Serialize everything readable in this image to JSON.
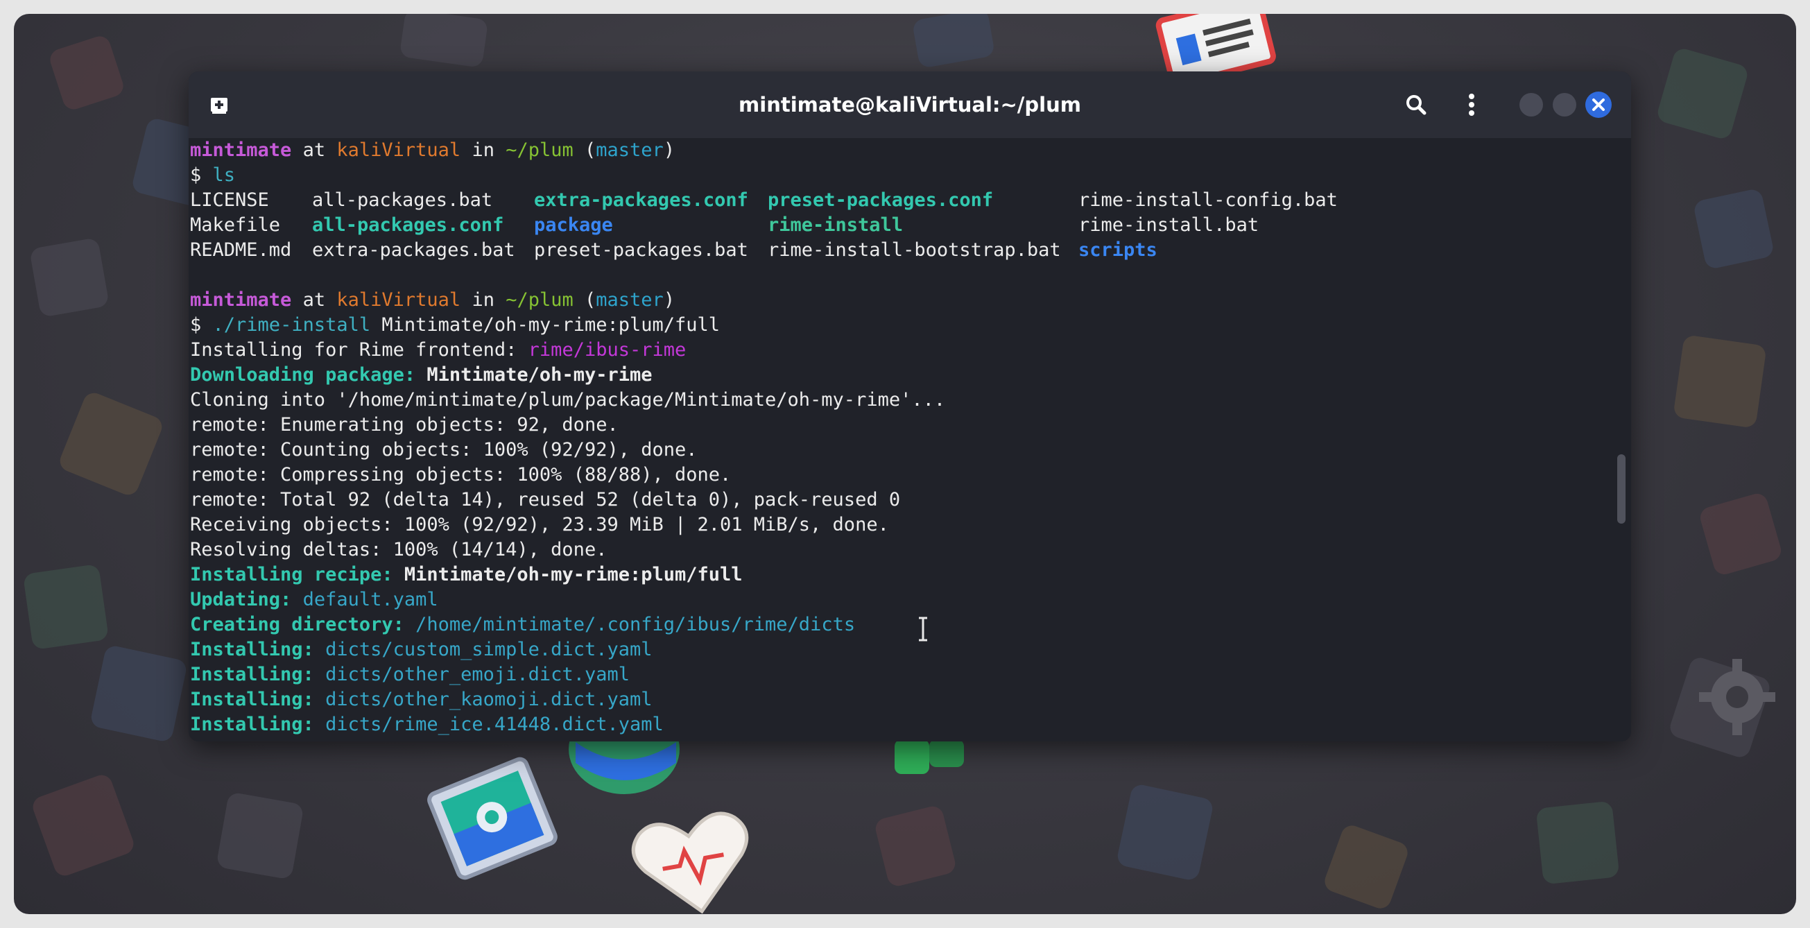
{
  "window": {
    "title": "mintimate@kaliVirtual:~/plum"
  },
  "prompt": {
    "user": "mintimate",
    "at": "at",
    "host": "kaliVirtual",
    "in": "in",
    "path": "~/plum",
    "branch": "master",
    "symbol": "$"
  },
  "commands": {
    "ls": "ls",
    "install_exe": "./rime-install",
    "install_arg": "Mintimate/oh-my-rime:plum/full"
  },
  "ls_output": {
    "row1": [
      "LICENSE",
      "all-packages.bat",
      "extra-packages.conf",
      "preset-packages.conf",
      "rime-install-config.bat"
    ],
    "row2": [
      "Makefile",
      "all-packages.conf",
      "package",
      "rime-install",
      "rime-install.bat"
    ],
    "row3": [
      "README.md",
      "extra-packages.bat",
      "preset-packages.bat",
      "rime-install-bootstrap.bat",
      "scripts"
    ]
  },
  "output": {
    "installing_for_label": "Installing for Rime frontend:",
    "installing_for_value": "rime/ibus-rime",
    "downloading_label": "Downloading package:",
    "downloading_value": "Mintimate/oh-my-rime",
    "cloning": "Cloning into '/home/mintimate/plum/package/Mintimate/oh-my-rime'...",
    "remote_enum": "remote: Enumerating objects: 92, done.",
    "remote_count": "remote: Counting objects: 100% (92/92), done.",
    "remote_compress": "remote: Compressing objects: 100% (88/88), done.",
    "remote_total": "remote: Total 92 (delta 14), reused 52 (delta 0), pack-reused 0",
    "receiving": "Receiving objects: 100% (92/92), 23.39 MiB | 2.01 MiB/s, done.",
    "resolving": "Resolving deltas: 100% (14/14), done.",
    "recipe_label": "Installing recipe:",
    "recipe_value": "Mintimate/oh-my-rime:plum/full",
    "updating_label": "Updating:",
    "updating_value": "default.yaml",
    "creating_label": "Creating directory:",
    "creating_value": "/home/mintimate/.config/ibus/rime/dicts",
    "installing_label": "Installing:",
    "install_files": [
      "dicts/custom_simple.dict.yaml",
      "dicts/other_emoji.dict.yaml",
      "dicts/other_kaomoji.dict.yaml",
      "dicts/rime_ice.41448.dict.yaml"
    ]
  },
  "icons": {
    "new_tab": "new-tab-icon",
    "search": "search-icon",
    "menu": "kebab-menu-icon",
    "close": "close-icon"
  },
  "colors": {
    "terminal_bg": "#202229",
    "titlebar_bg": "#2b2d36",
    "close_button": "#2f6bde",
    "user": "#c65ad8",
    "host": "#e07a2e",
    "path": "#86c233",
    "branch": "#2ea4cc"
  }
}
